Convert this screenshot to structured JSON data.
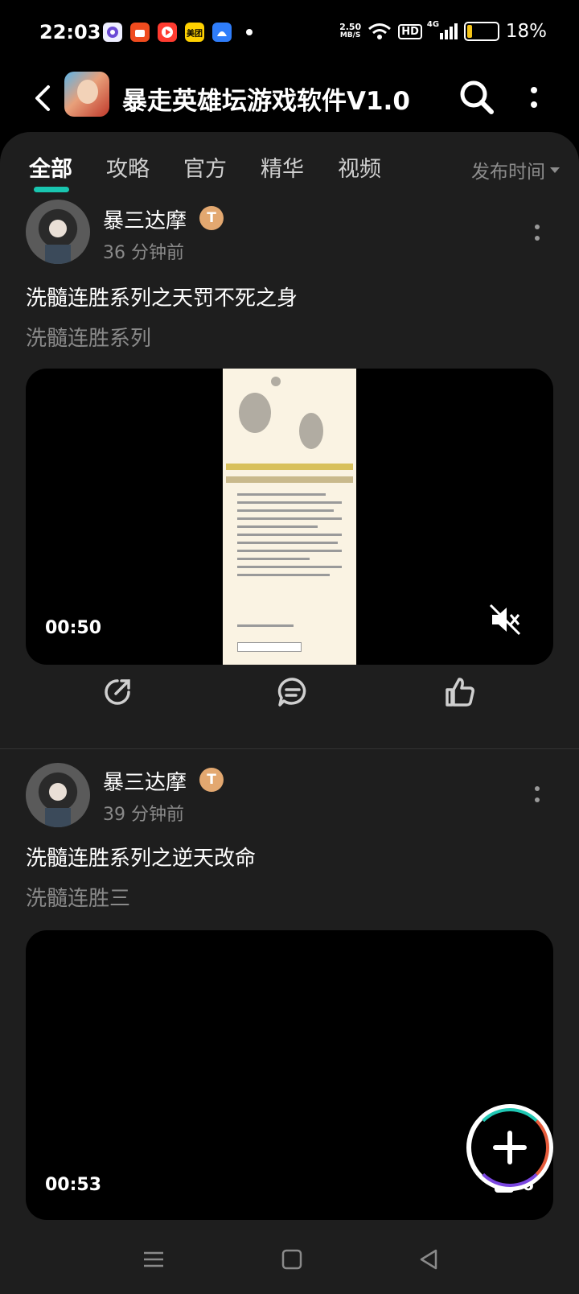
{
  "status": {
    "time": "22:03",
    "net_speed_value": "2.50",
    "net_speed_unit": "MB/S",
    "hd": "HD",
    "network": "4G",
    "battery_percent": "18%",
    "battery_level": 0.18,
    "app_icons": [
      "browser-icon",
      "taobao-icon",
      "video-app-icon",
      "meituan-icon",
      "maps-icon"
    ],
    "meituan_label": "美团"
  },
  "header": {
    "title": "暴走英雄坛游戏软件V1.0"
  },
  "tabs": [
    {
      "label": "全部",
      "active": true
    },
    {
      "label": "攻略",
      "active": false
    },
    {
      "label": "官方",
      "active": false
    },
    {
      "label": "精华",
      "active": false
    },
    {
      "label": "视频",
      "active": false
    }
  ],
  "sort": {
    "label": "发布时间"
  },
  "posts": [
    {
      "author": "暴三达摩",
      "level_badge": "T",
      "time": "36 分钟前",
      "title": "洗髓连胜系列之天罚不死之身",
      "tag": "洗髓连胜系列",
      "duration": "00:50",
      "muted": true
    },
    {
      "author": "暴三达摩",
      "level_badge": "T",
      "time": "39 分钟前",
      "title": "洗髓连胜系列之逆天改命",
      "tag": "洗髓连胜三",
      "duration": "00:53",
      "views": "6"
    }
  ],
  "colors": {
    "accent": "#19c6b0",
    "background": "#1e1e1e",
    "badge": "#e3a870"
  }
}
